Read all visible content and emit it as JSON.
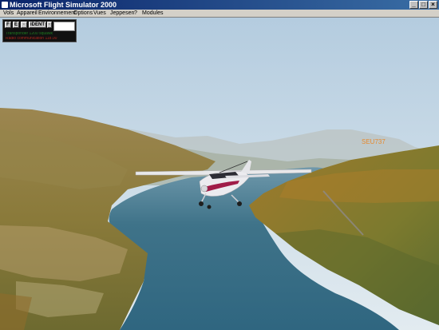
{
  "window": {
    "title": "Microsoft Flight Simulator 2000"
  },
  "menu": {
    "items": [
      "Vols",
      "Appareil",
      "Environnement",
      "Options",
      "Vues",
      "Jeppesen",
      "?",
      "Modules"
    ]
  },
  "window_buttons": {
    "minimize": "_",
    "maximize": "□",
    "close": "×"
  },
  "radio_panel": {
    "button_e": "E",
    "button_ident": "IDENT",
    "status_line_1": "Transponder 1200 squawk",
    "status_line_2": "Radio communication 118.00"
  },
  "scene": {
    "aircraft_label": "SEU737"
  },
  "colors": {
    "title_bar": "#0a246a",
    "sky_top": "#b4ccdf",
    "water": "#3b6f86"
  }
}
